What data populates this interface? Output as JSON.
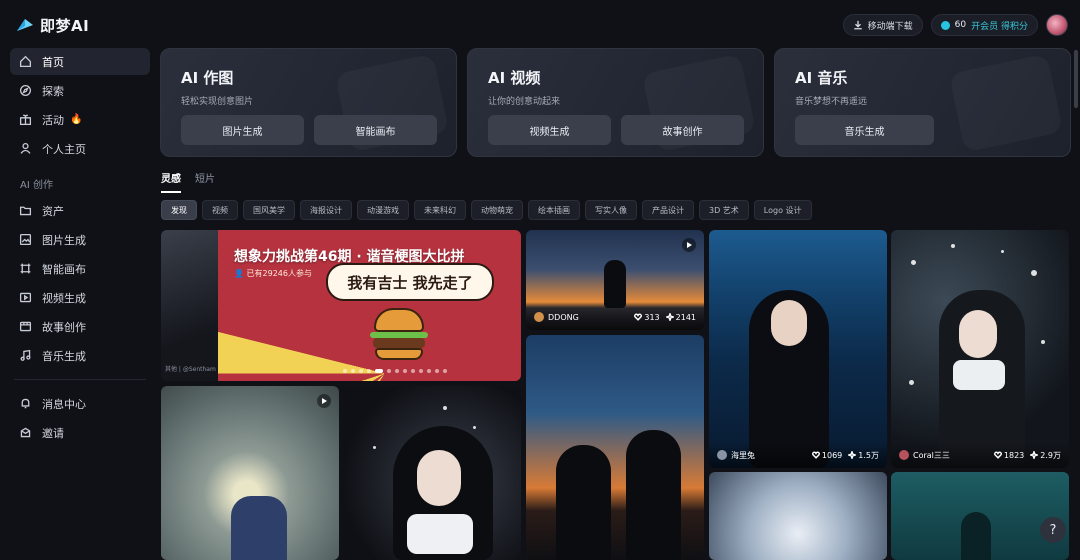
{
  "app": {
    "name": "即梦AI"
  },
  "header": {
    "download_label": "移动端下载",
    "credits": "60",
    "vip_label": "开会员 得积分"
  },
  "sidebar": {
    "items": [
      {
        "label": "首页",
        "icon": "home-icon",
        "active": true
      },
      {
        "label": "探索",
        "icon": "compass-icon"
      },
      {
        "label": "活动",
        "icon": "gift-icon",
        "badge": "🔥"
      },
      {
        "label": "个人主页",
        "icon": "user-icon"
      }
    ],
    "section_title": "AI 创作",
    "create_items": [
      {
        "label": "资产",
        "icon": "folder-icon"
      },
      {
        "label": "图片生成",
        "icon": "image-icon"
      },
      {
        "label": "智能画布",
        "icon": "canvas-icon"
      },
      {
        "label": "视频生成",
        "icon": "video-icon"
      },
      {
        "label": "故事创作",
        "icon": "story-icon"
      },
      {
        "label": "音乐生成",
        "icon": "music-icon"
      }
    ],
    "bottom_items": [
      {
        "label": "消息中心",
        "icon": "bell-icon"
      },
      {
        "label": "邀请",
        "icon": "invite-icon"
      }
    ]
  },
  "cards": [
    {
      "title": "AI 作图",
      "subtitle": "轻松实现创意图片",
      "buttons": [
        "图片生成",
        "智能画布"
      ]
    },
    {
      "title": "AI 视频",
      "subtitle": "让你的创意动起来",
      "buttons": [
        "视频生成",
        "故事创作"
      ]
    },
    {
      "title": "AI 音乐",
      "subtitle": "音乐梦想不再遥远",
      "buttons": [
        "音乐生成"
      ]
    }
  ],
  "tabs": [
    {
      "label": "灵感",
      "active": true
    },
    {
      "label": "短片"
    }
  ],
  "filters": [
    "发现",
    "视频",
    "国风美学",
    "海报设计",
    "动漫游戏",
    "未来科幻",
    "动物萌宠",
    "绘本插画",
    "写实人像",
    "产品设计",
    "3D 艺术",
    "Logo 设计"
  ],
  "banner": {
    "title": "想象力挑战第46期 · 谐音梗图大比拼",
    "participants": "已有29246人参与",
    "speech": "我有吉士 我先走了",
    "credit": "其他 | @Sentham",
    "dots_total": 13,
    "dots_active": 4
  },
  "gallery": [
    {
      "id": "a",
      "author": "DDONG",
      "likes": "313",
      "uses": "2141",
      "video": true
    },
    {
      "id": "b",
      "author": "海里兔",
      "likes": "1069",
      "uses": "1.5万"
    },
    {
      "id": "c",
      "author": "Coral三三",
      "likes": "1823",
      "uses": "2.9万"
    },
    {
      "id": "e",
      "video": true
    }
  ],
  "help_label": "?"
}
